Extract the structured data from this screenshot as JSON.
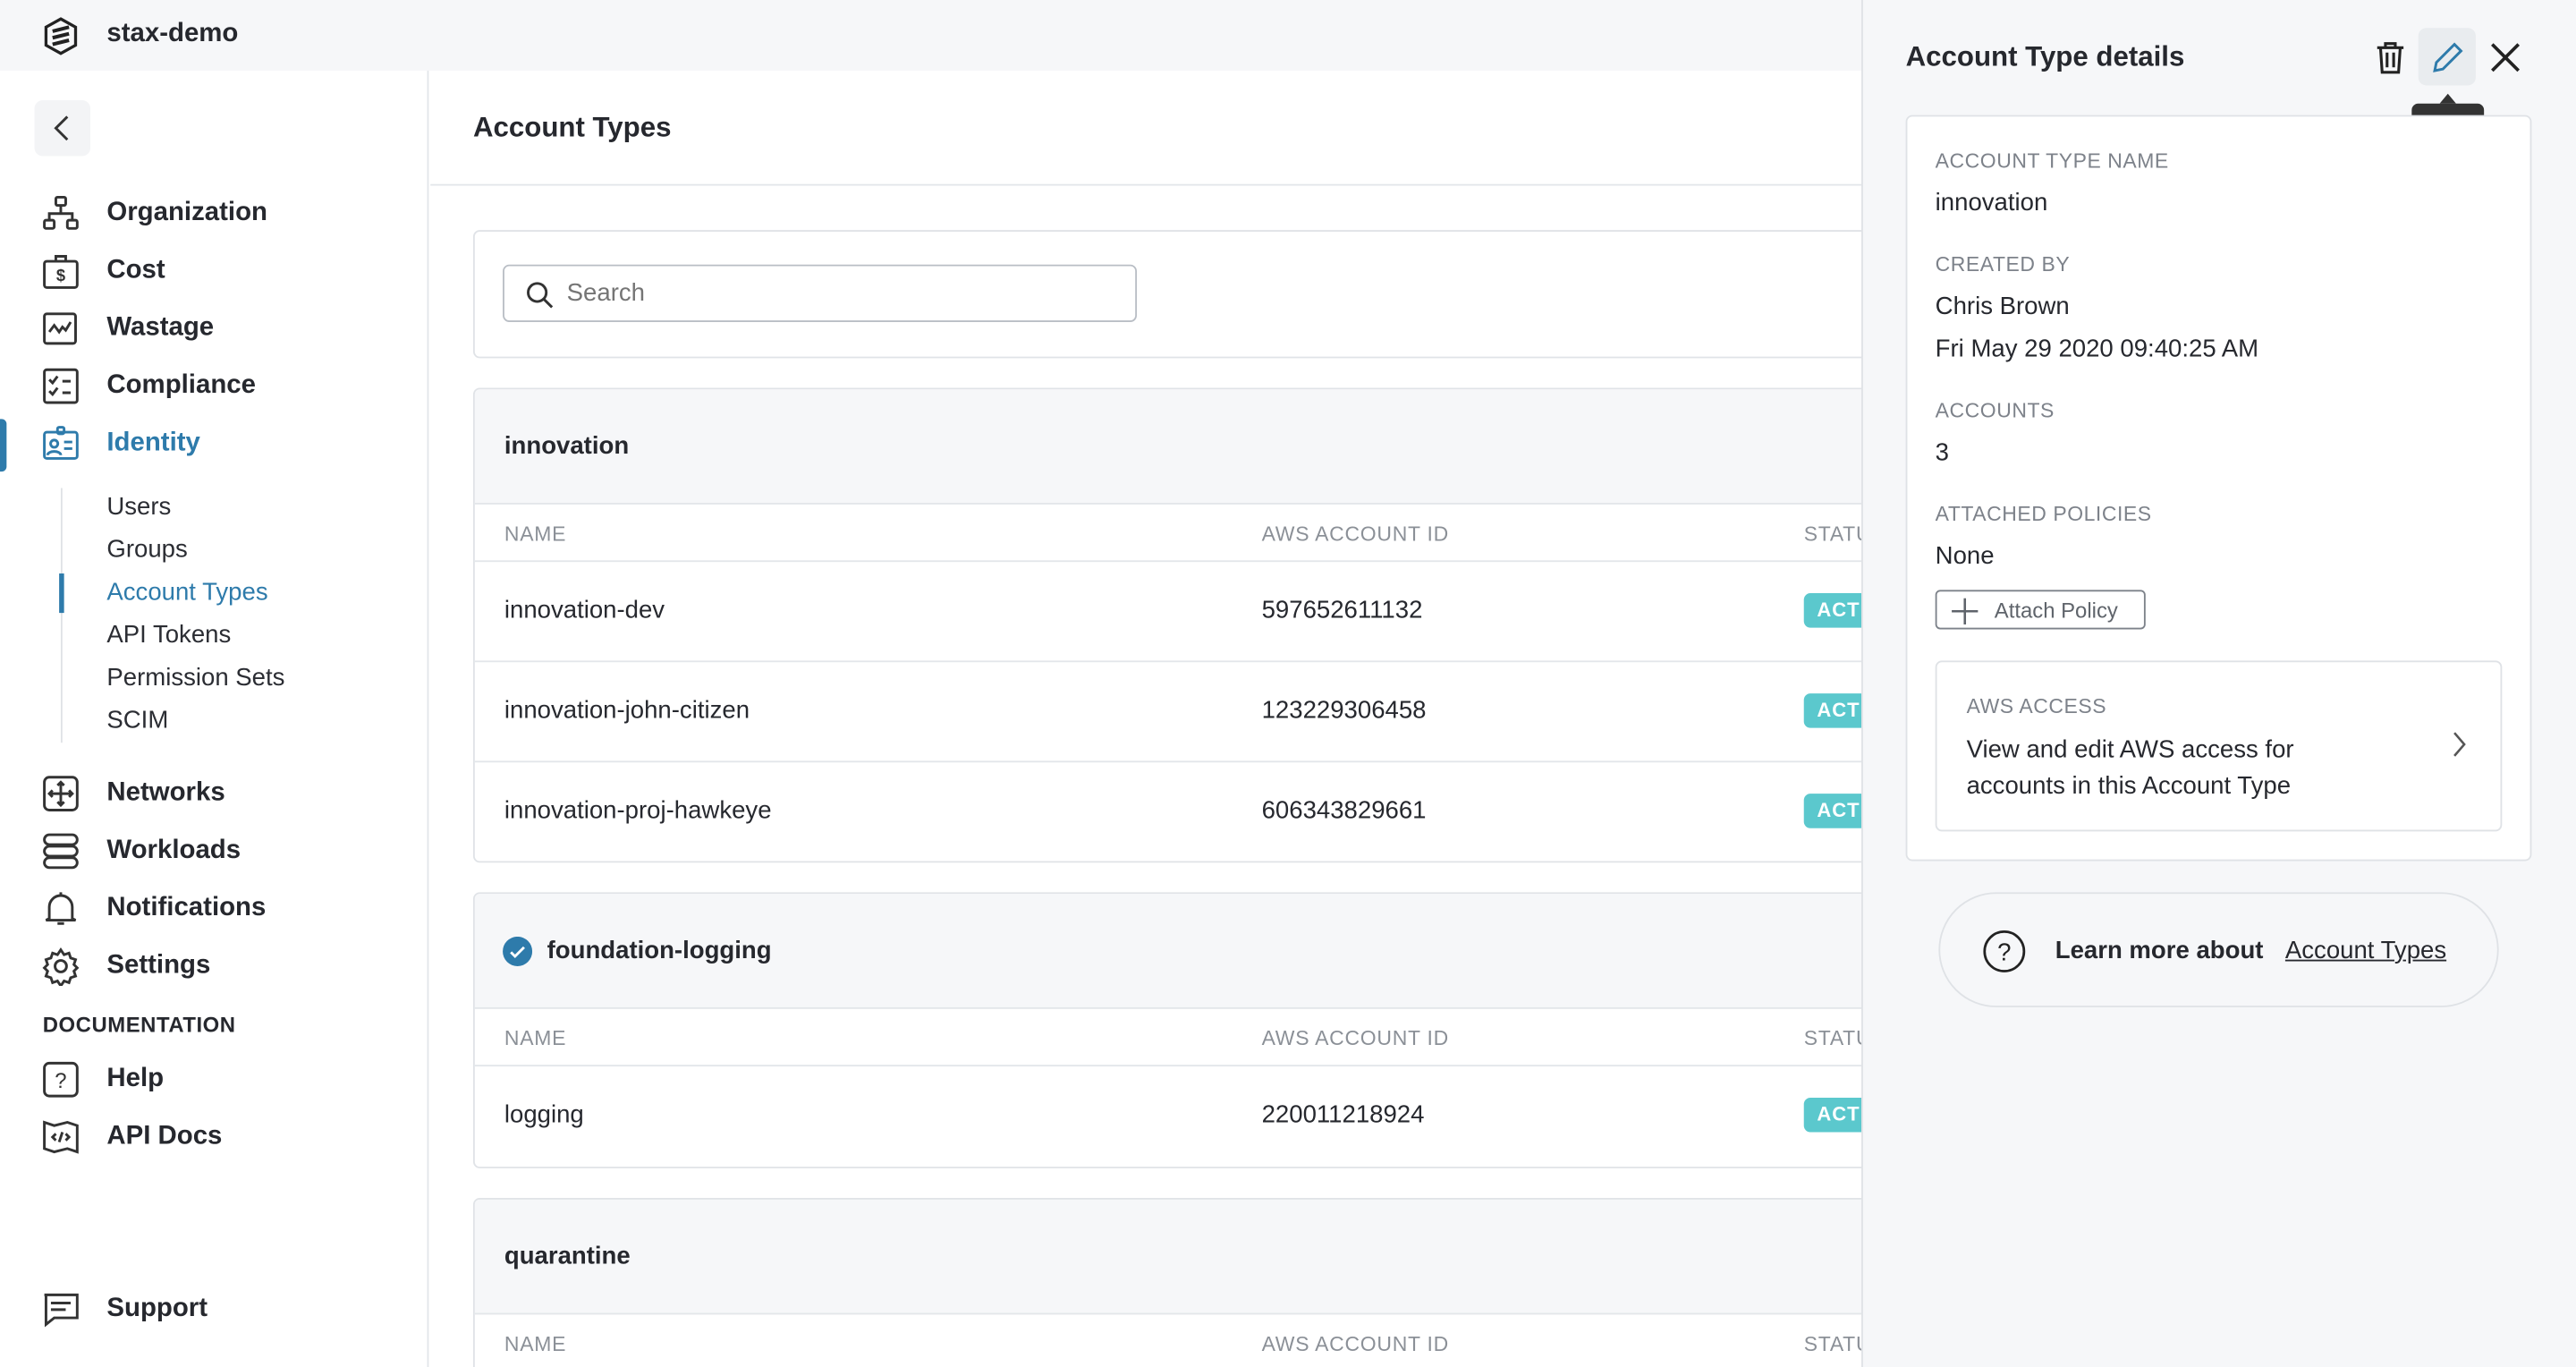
{
  "topbar": {
    "org_name": "stax-demo"
  },
  "sidebar": {
    "nav": [
      {
        "label": "Organization"
      },
      {
        "label": "Cost"
      },
      {
        "label": "Wastage"
      },
      {
        "label": "Compliance"
      },
      {
        "label": "Identity"
      }
    ],
    "identity_sub": [
      {
        "label": "Users"
      },
      {
        "label": "Groups"
      },
      {
        "label": "Account Types"
      },
      {
        "label": "API Tokens"
      },
      {
        "label": "Permission Sets"
      },
      {
        "label": "SCIM"
      }
    ],
    "nav2": [
      {
        "label": "Networks"
      },
      {
        "label": "Workloads"
      },
      {
        "label": "Notifications"
      },
      {
        "label": "Settings"
      }
    ],
    "documentation_heading": "DOCUMENTATION",
    "docs": [
      {
        "label": "Help"
      },
      {
        "label": "API Docs"
      }
    ],
    "support": "Support",
    "accent": "#2e7bab"
  },
  "main": {
    "title": "Account Types",
    "search_placeholder": "Search",
    "columns": {
      "name": "NAME",
      "aws_id": "AWS ACCOUNT ID",
      "status": "STATUS"
    },
    "groups": [
      {
        "name": "innovation",
        "rows": [
          {
            "name": "innovation-dev",
            "id": "597652611132",
            "status": "ACTIVE"
          },
          {
            "name": "innovation-john-citizen",
            "id": "123229306458",
            "status": "ACTIVE"
          },
          {
            "name": "innovation-proj-hawkeye",
            "id": "606343829661",
            "status": "ACTIVE"
          }
        ]
      },
      {
        "name": "foundation-logging",
        "verified": true,
        "rows": [
          {
            "name": "logging",
            "id": "220011218924",
            "status": "ACTIVE"
          }
        ]
      },
      {
        "name": "quarantine",
        "rows": []
      }
    ],
    "status_color": "#5bc8cd"
  },
  "panel": {
    "title": "Account Type details",
    "edit_tooltip": "Edit",
    "name_label": "ACCOUNT TYPE NAME",
    "name_value": "innovation",
    "created_label": "CREATED BY",
    "created_by": "Chris Brown",
    "created_at": "Fri May 29 2020 09:40:25 AM",
    "accounts_label": "ACCOUNTS",
    "accounts_value": "3",
    "policies_label": "ATTACHED POLICIES",
    "policies_value": "None",
    "attach_button": "Attach Policy",
    "aws_access_label": "AWS ACCESS",
    "aws_access_text": "View and edit AWS access for accounts in this Account Type",
    "learn_more": "Learn more about",
    "learn_link": "Account Types"
  }
}
